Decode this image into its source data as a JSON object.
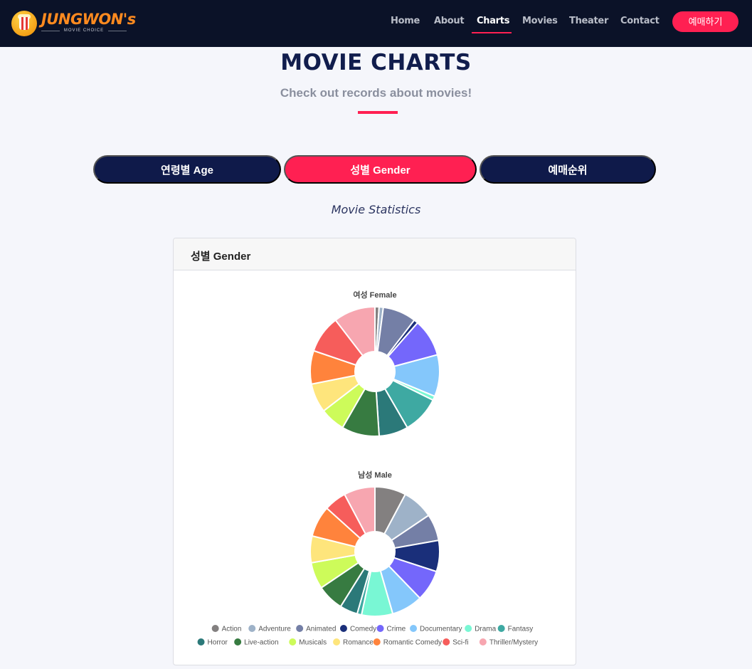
{
  "nav": {
    "logo_text": "JUNGWON's",
    "logo_sub": "MOVIE CHOICE",
    "links": [
      {
        "label": "Home"
      },
      {
        "label": "About"
      },
      {
        "label": "Charts"
      },
      {
        "label": "Movies"
      },
      {
        "label": "Theater"
      },
      {
        "label": "Contact"
      }
    ],
    "active": "Charts",
    "book_label": "예매하기"
  },
  "header": {
    "title": "MOVIE CHARTS",
    "subtitle": "Check out records about movies!"
  },
  "tabs": [
    {
      "label": "연령별 Age"
    },
    {
      "label": "성별 Gender"
    },
    {
      "label": "예매순위"
    }
  ],
  "active_tab": "성별 Gender",
  "section_caption": "Movie Statistics",
  "card": {
    "title": "성별 Gender"
  },
  "colors": {
    "navbar": "#0b1228",
    "accent": "#ff2052",
    "tab_dark": "#0f1a4a"
  },
  "chart_data": [
    {
      "type": "pie",
      "title": "여성 Female",
      "donut": true,
      "categories": [
        "Action",
        "Adventure",
        "Animated",
        "Comedy",
        "Crime",
        "Documentary",
        "Drama",
        "Fantasy",
        "Horror",
        "Live-action",
        "Musicals",
        "Romance",
        "Romantic Comedy",
        "Sci-fi",
        "Thriller/Mystery"
      ],
      "values": [
        1,
        1,
        8,
        1,
        9,
        10,
        1,
        9,
        7,
        9,
        6,
        7,
        8,
        9,
        10
      ],
      "colors": [
        "#838080",
        "#9eb2c8",
        "#747fa6",
        "#1a2f7a",
        "#7467fb",
        "#84c7fb",
        "#79f7d4",
        "#3ea9a2",
        "#2b7979",
        "#377b41",
        "#cdfb5a",
        "#fee57c",
        "#ff833c",
        "#f65d5b",
        "#f7a6b0"
      ],
      "legend": "bottom"
    },
    {
      "type": "pie",
      "title": "남성 Male",
      "donut": true,
      "categories": [
        "Action",
        "Adventure",
        "Animated",
        "Comedy",
        "Crime",
        "Documentary",
        "Drama",
        "Fantasy",
        "Horror",
        "Live-action",
        "Musicals",
        "Romance",
        "Romantic Comedy",
        "Sci-fi",
        "Thriller/Mystery"
      ],
      "values": [
        7,
        7,
        6,
        7,
        7,
        7,
        7,
        1,
        4,
        6,
        6,
        6,
        7,
        5,
        7
      ],
      "colors": [
        "#838080",
        "#9eb2c8",
        "#747fa6",
        "#1a2f7a",
        "#7467fb",
        "#84c7fb",
        "#79f7d4",
        "#3ea9a2",
        "#2b7979",
        "#377b41",
        "#cdfb5a",
        "#fee57c",
        "#ff833c",
        "#f65d5b",
        "#f7a6b0"
      ],
      "legend": "bottom"
    }
  ]
}
